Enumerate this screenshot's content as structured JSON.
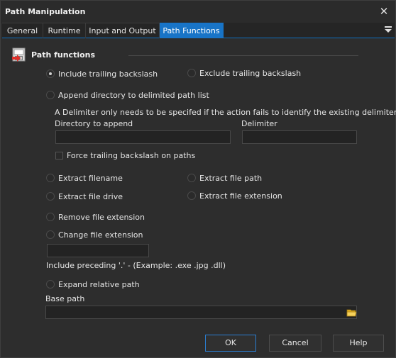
{
  "window": {
    "title": "Path Manipulation",
    "close_glyph": "✕"
  },
  "tabs": [
    {
      "label": "General"
    },
    {
      "label": "Runtime"
    },
    {
      "label": "Input and Output"
    },
    {
      "label": "Path Functions",
      "active": true
    }
  ],
  "group": {
    "title": "Path functions",
    "icon": "path-functions-icon"
  },
  "options": {
    "include_trailing": {
      "label": "Include trailing backslash",
      "checked": true
    },
    "exclude_trailing": {
      "label": "Exclude trailing backslash",
      "checked": false
    },
    "append_directory": {
      "label": "Append directory to delimited path list",
      "checked": false
    },
    "delimiter_note": "A Delimiter only needs to be specifed if the action fails to identify the existing delimiter",
    "directory_label": "Directory to append",
    "directory_value": "",
    "delimiter_label": "Delimiter",
    "delimiter_value": "",
    "force_trailing": {
      "label": "Force trailing backslash on paths",
      "checked": false
    },
    "extract_filename": {
      "label": "Extract filename",
      "checked": false
    },
    "extract_file_path": {
      "label": "Extract file path",
      "checked": false
    },
    "extract_file_drive": {
      "label": "Extract file drive",
      "checked": false
    },
    "extract_file_extension": {
      "label": "Extract file extension",
      "checked": false
    },
    "remove_file_extension": {
      "label": "Remove file extension",
      "checked": false
    },
    "change_file_extension": {
      "label": "Change file extension",
      "checked": false
    },
    "extension_value": "",
    "extension_note": "Include preceding '.' - (Example:  .exe  .jpg  .dll)",
    "expand_relative": {
      "label": "Expand relative path",
      "checked": false
    },
    "base_path_label": "Base path",
    "base_path_value": ""
  },
  "buttons": {
    "ok": "OK",
    "cancel": "Cancel",
    "help": "Help"
  },
  "colors": {
    "accent": "#1874c7",
    "background": "#2d2d2d",
    "text": "#e6e6e6"
  }
}
